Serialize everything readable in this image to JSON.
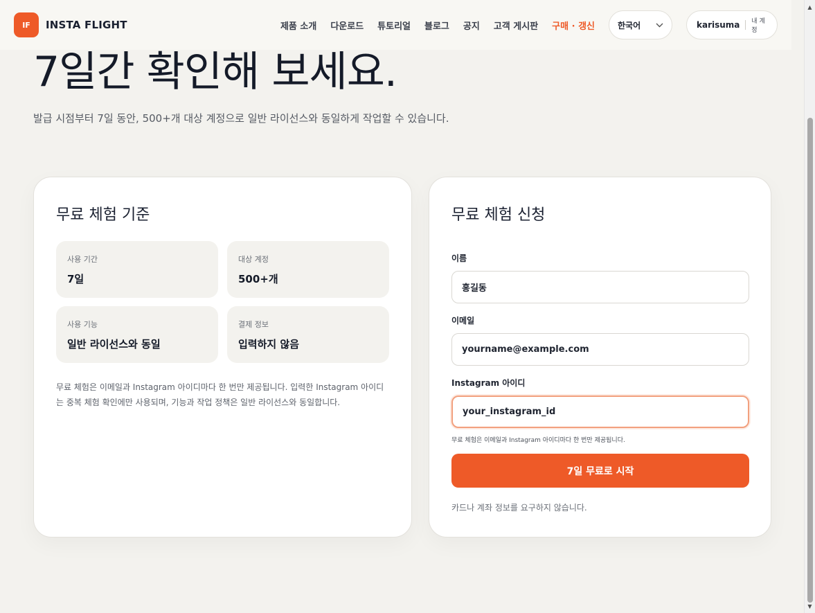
{
  "header": {
    "logo_text": "IF",
    "brand": "INSTA FLIGHT",
    "nav": [
      {
        "label": "제품 소개"
      },
      {
        "label": "다운로드"
      },
      {
        "label": "튜토리얼"
      },
      {
        "label": "블로그"
      },
      {
        "label": "공지"
      },
      {
        "label": "고객 게시판"
      },
      {
        "label": "구매 · 갱신"
      }
    ],
    "language": "한국어",
    "username": "karisuma",
    "my_account": "내 계정"
  },
  "hero": {
    "title": "7일간 확인해 보세요.",
    "subtitle": "발급 시점부터 7일 동안, 500+개 대상 계정으로 일반 라이선스와 동일하게 작업할 수 있습니다."
  },
  "criteria": {
    "title": "무료 체험 기준",
    "items": [
      {
        "label": "사용 기간",
        "value": "7일"
      },
      {
        "label": "대상 계정",
        "value": "500+개"
      },
      {
        "label": "사용 기능",
        "value": "일반 라이선스와 동일"
      },
      {
        "label": "결제 정보",
        "value": "입력하지 않음"
      }
    ],
    "note": "무료 체험은 이메일과 Instagram 아이디마다 한 번만 제공됩니다. 입력한 Instagram 아이디는 중복 체험 확인에만 사용되며, 기능과 작업 정책은 일반 라이선스와 동일합니다."
  },
  "form": {
    "title": "무료 체험 신청",
    "name_label": "이름",
    "name_value": "홍길동",
    "email_label": "이메일",
    "email_value": "yourname@example.com",
    "ig_label": "Instagram 아이디",
    "ig_value": "your_instagram_id",
    "hint": "무료 체험은 이메일과 Instagram 아이디마다 한 번만 제공됩니다.",
    "submit_label": "7일 무료로 시작",
    "footnote": "카드나 계좌 정보를 요구하지 않습니다."
  },
  "colors": {
    "accent": "#ee5a28",
    "background": "#f3f2ee"
  }
}
